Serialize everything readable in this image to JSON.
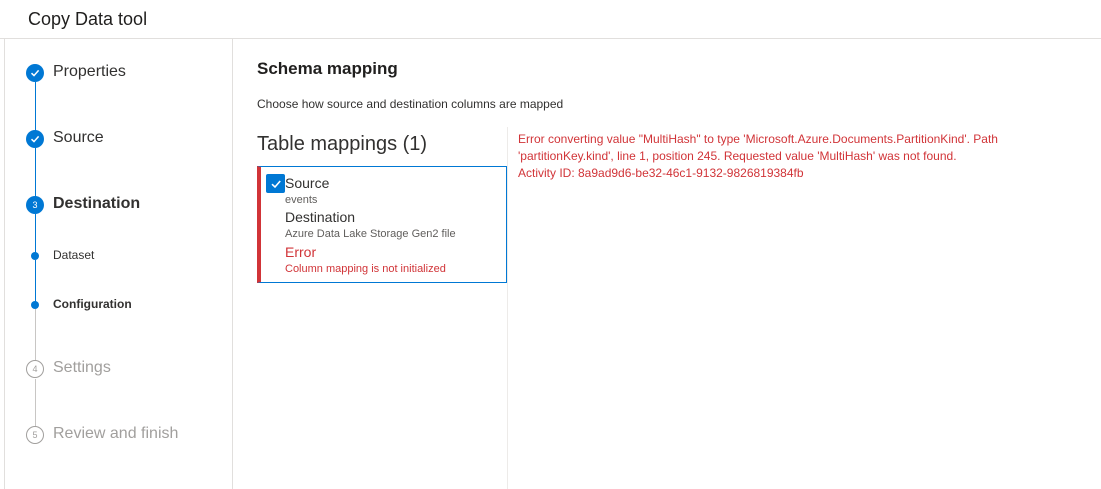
{
  "window": {
    "title": "Copy Data tool"
  },
  "stepper": {
    "steps": [
      {
        "label": "Properties",
        "state": "done",
        "number": "1"
      },
      {
        "label": "Source",
        "state": "done",
        "number": "2"
      },
      {
        "label": "Destination",
        "state": "current",
        "number": "3"
      },
      {
        "label": "Settings",
        "state": "pending",
        "number": "4"
      },
      {
        "label": "Review and finish",
        "state": "pending",
        "number": "5"
      }
    ],
    "substeps": [
      {
        "label": "Dataset",
        "state": "done"
      },
      {
        "label": "Configuration",
        "state": "current"
      }
    ]
  },
  "main": {
    "heading": "Schema mapping",
    "description": "Choose how source and destination columns are mapped",
    "table_mappings_heading": "Table mappings (1)",
    "mapping": {
      "source_label": "Source",
      "source_value": "events",
      "destination_label": "Destination",
      "destination_value": "Azure Data Lake Storage Gen2 file",
      "error_label": "Error",
      "error_value": "Column mapping is not initialized",
      "checked": true
    },
    "error_message": {
      "line1": "Error converting value \"MultiHash\" to type 'Microsoft.Azure.Documents.PartitionKind'. Path",
      "line2": "'partitionKey.kind', line 1, position 245. Requested value 'MultiHash' was not found.",
      "line3": "Activity ID: 8a9ad9d6-be32-46c1-9132-9826819384fb"
    }
  },
  "colors": {
    "accent": "#0078d4",
    "error": "#d13438",
    "pending": "#a19f9d"
  }
}
